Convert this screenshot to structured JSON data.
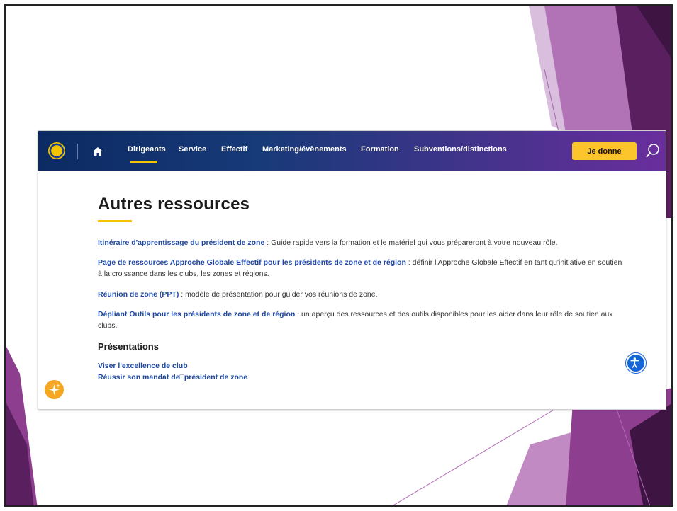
{
  "nav": {
    "items": [
      {
        "label": "Dirigeants"
      },
      {
        "label": "Service"
      },
      {
        "label": "Effectif"
      },
      {
        "label": "Marketing/évènements"
      },
      {
        "label": "Formation"
      },
      {
        "label": "Subventions/distinctions"
      }
    ],
    "donate_label": "Je donne"
  },
  "colors": {
    "accent": "#f5c400",
    "link": "#1d47a3",
    "nav_start": "#0c2a63",
    "nav_end": "#6a2e9c",
    "deco_purple": "#8e3e8f"
  },
  "icons": [
    "lions-logo-icon",
    "home-icon",
    "search-icon",
    "accessibility-icon",
    "sparkle-icon"
  ],
  "main": {
    "title": "Autres ressources",
    "resources": [
      {
        "link": "Itinéraire d'apprentissage du président de zone",
        "text": " : Guide rapide vers la formation et le matériel qui vous prépareront à votre nouveau rôle."
      },
      {
        "link": "Page de ressources Approche Globale Effectif pour les présidents de zone et de région",
        "text": " : définir l'Approche Globale Effectif en tant qu'initiative en soutien à la croissance dans les clubs, les zones et régions."
      },
      {
        "link": "Réunion de zone (PPT)",
        "text": " : modèle de présentation pour guider vos réunions de zone."
      },
      {
        "link": "Dépliant Outils pour les présidents de zone et de région",
        "text": " : un aperçu des ressources et des outils disponibles pour les aider dans leur rôle de soutien aux clubs."
      }
    ],
    "presentations_heading": "Présentations",
    "presentation_links": [
      "Viser l'excellence de club",
      "Réussir son mandat de□président de zone"
    ]
  }
}
